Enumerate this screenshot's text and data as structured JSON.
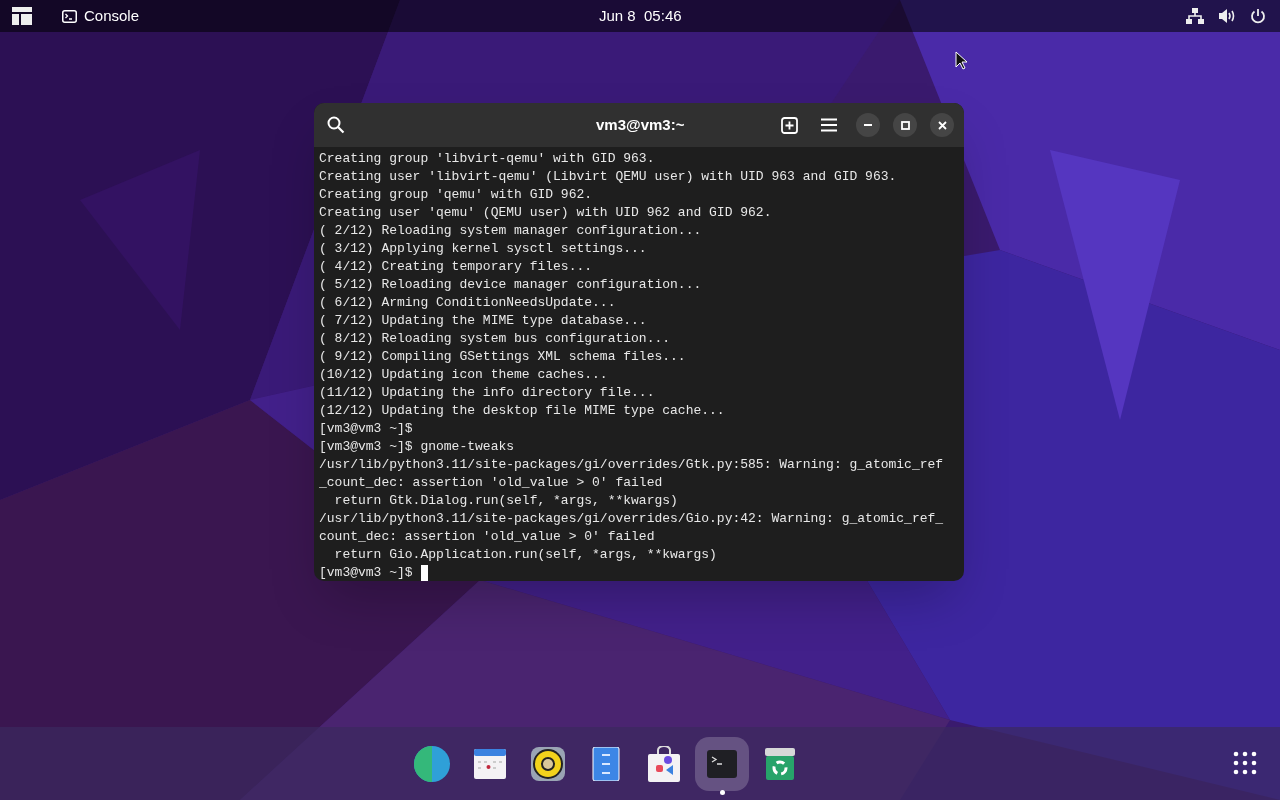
{
  "top_bar": {
    "app_menu": "Console",
    "clock": "Jun 8  05:46"
  },
  "terminal": {
    "title": "vm3@vm3:~",
    "lines": [
      "Creating group 'libvirt-qemu' with GID 963.",
      "Creating user 'libvirt-qemu' (Libvirt QEMU user) with UID 963 and GID 963.",
      "Creating group 'qemu' with GID 962.",
      "Creating user 'qemu' (QEMU user) with UID 962 and GID 962.",
      "( 2/12) Reloading system manager configuration...",
      "( 3/12) Applying kernel sysctl settings...",
      "( 4/12) Creating temporary files...",
      "( 5/12) Reloading device manager configuration...",
      "( 6/12) Arming ConditionNeedsUpdate...",
      "( 7/12) Updating the MIME type database...",
      "( 8/12) Reloading system bus configuration...",
      "( 9/12) Compiling GSettings XML schema files...",
      "(10/12) Updating icon theme caches...",
      "(11/12) Updating the info directory file...",
      "(12/12) Updating the desktop file MIME type cache...",
      "[vm3@vm3 ~]$",
      "[vm3@vm3 ~]$ gnome-tweaks",
      "/usr/lib/python3.11/site-packages/gi/overrides/Gtk.py:585: Warning: g_atomic_ref",
      "_count_dec: assertion 'old_value > 0' failed",
      "  return Gtk.Dialog.run(self, *args, **kwargs)",
      "/usr/lib/python3.11/site-packages/gi/overrides/Gio.py:42: Warning: g_atomic_ref_",
      "count_dec: assertion 'old_value > 0' failed",
      "  return Gio.Application.run(self, *args, **kwargs)"
    ],
    "prompt": "[vm3@vm3 ~]$"
  },
  "dock": [
    {
      "kind": "browser",
      "active": false
    },
    {
      "kind": "calendar",
      "active": false
    },
    {
      "kind": "speaker",
      "active": false
    },
    {
      "kind": "files",
      "active": false
    },
    {
      "kind": "store",
      "active": false
    },
    {
      "kind": "terminal",
      "active": true
    },
    {
      "kind": "trash",
      "active": false
    }
  ]
}
